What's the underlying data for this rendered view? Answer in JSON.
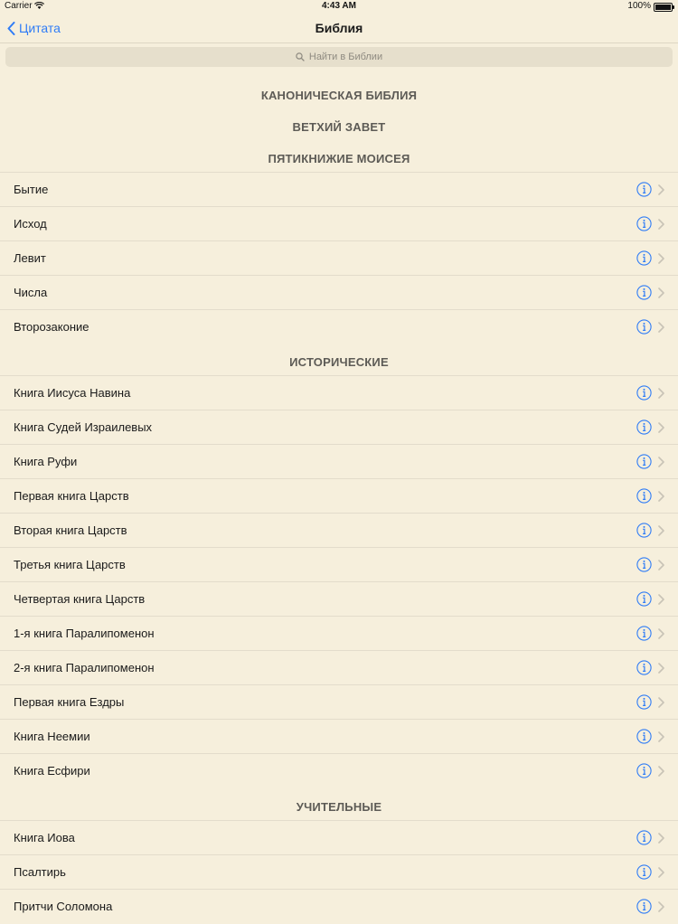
{
  "status": {
    "carrier": "Carrier",
    "time": "4:43 AM",
    "battery": "100%"
  },
  "nav": {
    "back_label": "Цитата",
    "title": "Библия"
  },
  "search": {
    "placeholder": "Найти в Библии"
  },
  "headers": {
    "canon": "КАНОНИЧЕСКАЯ БИБЛИЯ",
    "old_testament": "ВЕТХИЙ ЗАВЕТ"
  },
  "sections": [
    {
      "title": "ПЯТИКНИЖИЕ МОИСЕЯ",
      "items": [
        "Бытие",
        "Исход",
        "Левит",
        "Числа",
        "Второзаконие"
      ]
    },
    {
      "title": "ИСТОРИЧЕСКИЕ",
      "items": [
        "Книга Иисуса Навина",
        "Книга Судей Израилевых",
        "Книга Руфи",
        "Первая книга Царств",
        "Вторая книга Царств",
        "Третья книга Царств",
        "Четвертая книга Царств",
        "1-я книга Паралипоменон",
        "2-я книга Паралипоменон",
        "Первая книга Ездры",
        "Книга Неемии",
        "Книга Есфири"
      ]
    },
    {
      "title": "УЧИТЕЛЬНЫЕ",
      "items": [
        "Книга Иова",
        "Псалтирь",
        "Притчи Соломона"
      ]
    }
  ],
  "colors": {
    "background": "#f6efdc",
    "accent": "#2f7cf6",
    "separator": "#e3dccb"
  },
  "icons": {
    "row_info": "info-circle-icon",
    "row_disclosure": "chevron-right-icon"
  }
}
